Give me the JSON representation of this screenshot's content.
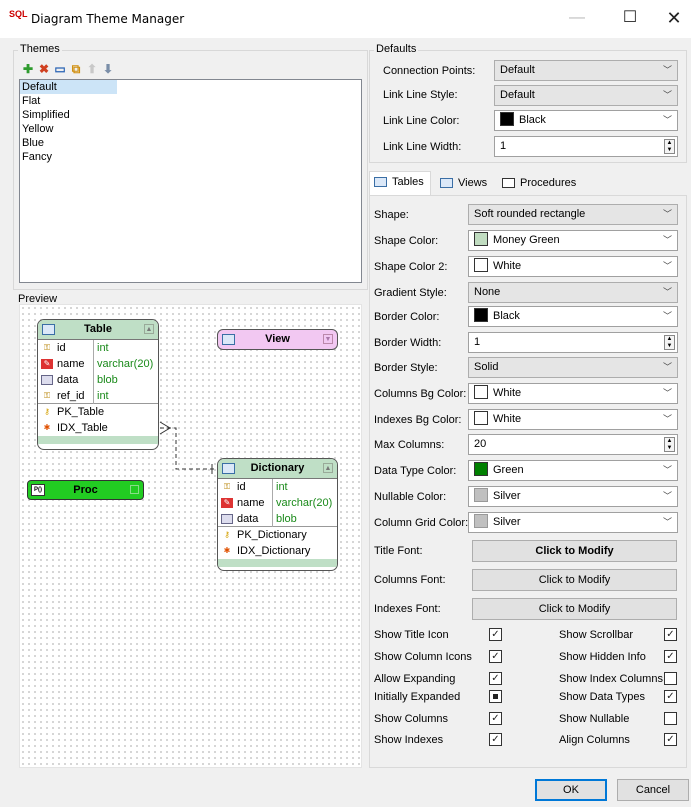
{
  "window": {
    "icon_text": "SQL",
    "title": "Diagram Theme Manager",
    "min": "—",
    "max": "☐",
    "close": "✕"
  },
  "themes": {
    "label": "Themes",
    "toolbar": {
      "add": "✚",
      "delete": "✖",
      "rename": "▭",
      "copy": "⧉",
      "up": "⬆",
      "down": "⬇"
    },
    "items": [
      "Default",
      "Flat",
      "Simplified",
      "Yellow",
      "Blue",
      "Fancy"
    ],
    "selected": "Default"
  },
  "preview": {
    "label": "Preview",
    "table": {
      "name": "Table",
      "rows": [
        {
          "icon": "key",
          "name": "id",
          "type": "int"
        },
        {
          "icon": "field",
          "name": "name",
          "type": "varchar(20)"
        },
        {
          "icon": "blob",
          "name": "data",
          "type": "blob"
        },
        {
          "icon": "key",
          "name": "ref_id",
          "type": "int"
        }
      ],
      "indexes": [
        "PK_Table",
        "IDX_Table"
      ]
    },
    "view": {
      "name": "View"
    },
    "proc": {
      "name": "Proc",
      "icon_text": "P()"
    },
    "dictionary": {
      "name": "Dictionary",
      "rows": [
        {
          "icon": "key",
          "name": "id",
          "type": "int"
        },
        {
          "icon": "field",
          "name": "name",
          "type": "varchar(20)"
        },
        {
          "icon": "blob",
          "name": "data",
          "type": "blob"
        }
      ],
      "indexes": [
        "PK_Dictionary",
        "IDX_Dictionary"
      ]
    }
  },
  "defaults": {
    "label": "Defaults",
    "connection_points": {
      "label": "Connection Points:",
      "value": "Default"
    },
    "link_line_style": {
      "label": "Link Line Style:",
      "value": "Default"
    },
    "link_line_color": {
      "label": "Link Line Color:",
      "value": "Black",
      "color": "#000000"
    },
    "link_line_width": {
      "label": "Link Line Width:",
      "value": "1"
    }
  },
  "tabs": [
    {
      "label": "Tables",
      "active": true
    },
    {
      "label": "Views",
      "active": false
    },
    {
      "label": "Procedures",
      "active": false
    }
  ],
  "props": {
    "shape": {
      "label": "Shape:",
      "value": "Soft rounded rectangle"
    },
    "shape_color": {
      "label": "Shape Color:",
      "value": "Money Green",
      "color": "#c0dcc0"
    },
    "shape_color2": {
      "label": "Shape Color 2:",
      "value": "White",
      "color": "#ffffff"
    },
    "gradient_style": {
      "label": "Gradient Style:",
      "value": "None"
    },
    "border_color": {
      "label": "Border Color:",
      "value": "Black",
      "color": "#000000"
    },
    "border_width": {
      "label": "Border Width:",
      "value": "1"
    },
    "border_style": {
      "label": "Border Style:",
      "value": "Solid"
    },
    "columns_bg": {
      "label": "Columns Bg Color:",
      "value": "White",
      "color": "#ffffff"
    },
    "indexes_bg": {
      "label": "Indexes Bg Color:",
      "value": "White",
      "color": "#ffffff"
    },
    "max_columns": {
      "label": "Max Columns:",
      "value": "20"
    },
    "data_type_color": {
      "label": "Data Type Color:",
      "value": "Green",
      "color": "#008000"
    },
    "nullable_color": {
      "label": "Nullable Color:",
      "value": "Silver",
      "color": "#c0c0c0"
    },
    "column_grid_color": {
      "label": "Column Grid Color:",
      "value": "Silver",
      "color": "#c0c0c0"
    },
    "title_font": {
      "label": "Title Font:",
      "button": "Click to Modify"
    },
    "columns_font": {
      "label": "Columns Font:",
      "button": "Click to Modify"
    },
    "indexes_font": {
      "label": "Indexes Font:",
      "button": "Click to Modify"
    }
  },
  "checks_left": [
    {
      "label": "Show Title Icon",
      "state": "checked"
    },
    {
      "label": "Show Column Icons",
      "state": "checked"
    },
    {
      "label": "Allow Expanding",
      "state": "checked"
    },
    {
      "label": "Initially Expanded",
      "state": "indeterminate"
    },
    {
      "label": "Show Columns",
      "state": "checked"
    },
    {
      "label": "Show Indexes",
      "state": "checked"
    }
  ],
  "checks_right": [
    {
      "label": "Show Scrollbar",
      "state": "checked"
    },
    {
      "label": "Show Hidden Info",
      "state": "checked"
    },
    {
      "label": "Show Index Columns",
      "state": "unchecked"
    },
    {
      "label": "Show Data Types",
      "state": "checked"
    },
    {
      "label": "Show Nullable",
      "state": "unchecked"
    },
    {
      "label": "Align Columns",
      "state": "checked"
    }
  ],
  "buttons": {
    "ok": "OK",
    "cancel": "Cancel"
  }
}
